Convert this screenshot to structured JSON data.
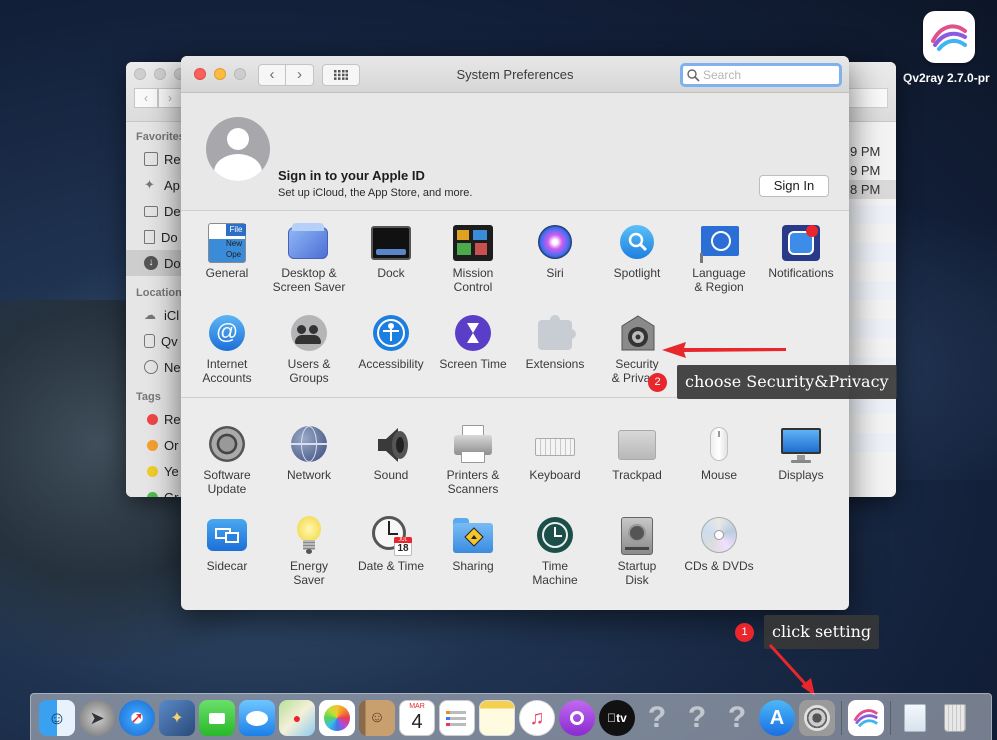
{
  "desktop": {
    "app_label": "Qv2ray 2.7.0-pr"
  },
  "finder": {
    "favorites_head": "Favorites",
    "favorites": [
      "Re",
      "Ap",
      "De",
      "Do",
      "Do"
    ],
    "locations_head": "Location",
    "locations": [
      "iCl",
      "Qv",
      "Ne"
    ],
    "tags_head": "Tags",
    "tags": [
      {
        "label": "Re",
        "color": "#f04646"
      },
      {
        "label": "Or",
        "color": "#f5a030"
      },
      {
        "label": "Ye",
        "color": "#f1cc2c"
      },
      {
        "label": "Gr",
        "color": "#4cbd4a"
      }
    ],
    "times": [
      "9 PM",
      "9 PM",
      "8 PM"
    ]
  },
  "window": {
    "title": "System Preferences",
    "search_placeholder": "Search"
  },
  "apple_id": {
    "title": "Sign in to your Apple ID",
    "subtitle": "Set up iCloud, the App Store, and more.",
    "button": "Sign In"
  },
  "panes_personal": [
    {
      "id": "general",
      "l1": "General",
      "l2": ""
    },
    {
      "id": "desktop",
      "l1": "Desktop &",
      "l2": "Screen Saver"
    },
    {
      "id": "dock",
      "l1": "Dock",
      "l2": ""
    },
    {
      "id": "mission",
      "l1": "Mission",
      "l2": "Control"
    },
    {
      "id": "siri",
      "l1": "Siri",
      "l2": ""
    },
    {
      "id": "spotlight",
      "l1": "Spotlight",
      "l2": ""
    },
    {
      "id": "language",
      "l1": "Language",
      "l2": "& Region"
    },
    {
      "id": "notifications",
      "l1": "Notifications",
      "l2": ""
    },
    {
      "id": "internet",
      "l1": "Internet",
      "l2": "Accounts"
    },
    {
      "id": "users",
      "l1": "Users &",
      "l2": "Groups"
    },
    {
      "id": "accessibility",
      "l1": "Accessibility",
      "l2": ""
    },
    {
      "id": "screentime",
      "l1": "Screen Time",
      "l2": ""
    },
    {
      "id": "extensions",
      "l1": "Extensions",
      "l2": ""
    },
    {
      "id": "security",
      "l1": "Security",
      "l2": "& Privacy"
    }
  ],
  "panes_hardware": [
    {
      "id": "swupdate",
      "l1": "Software",
      "l2": "Update"
    },
    {
      "id": "network",
      "l1": "Network",
      "l2": ""
    },
    {
      "id": "sound",
      "l1": "Sound",
      "l2": ""
    },
    {
      "id": "printers",
      "l1": "Printers &",
      "l2": "Scanners"
    },
    {
      "id": "keyboard",
      "l1": "Keyboard",
      "l2": ""
    },
    {
      "id": "trackpad",
      "l1": "Trackpad",
      "l2": ""
    },
    {
      "id": "mouse",
      "l1": "Mouse",
      "l2": ""
    },
    {
      "id": "displays",
      "l1": "Displays",
      "l2": ""
    },
    {
      "id": "sidecar",
      "l1": "Sidecar",
      "l2": ""
    },
    {
      "id": "energy",
      "l1": "Energy",
      "l2": "Saver"
    },
    {
      "id": "datetime",
      "l1": "Date & Time",
      "l2": ""
    },
    {
      "id": "sharing",
      "l1": "Sharing",
      "l2": ""
    },
    {
      "id": "timemachine",
      "l1": "Time",
      "l2": "Machine"
    },
    {
      "id": "startup",
      "l1": "Startup",
      "l2": "Disk"
    },
    {
      "id": "cds",
      "l1": "CDs & DVDs",
      "l2": ""
    }
  ],
  "file_icon_text": {
    "top": "File",
    "mid": "New",
    "bottom": "Ope"
  },
  "calendar_icon": {
    "month": "JUL",
    "day": "18"
  },
  "annotations": {
    "step1_badge": "1",
    "step1_text": "click setting",
    "step2_badge": "2",
    "step2_text": "choose Security&Privacy"
  },
  "dock": {
    "calendar_month": "MAR",
    "calendar_day": "4",
    "tv_label": "tv",
    "items": [
      "finder-icon",
      "launchpad-icon",
      "safari-icon",
      "photo-preview-icon",
      "facetime-icon",
      "messages-icon",
      "maps-icon",
      "photos-icon",
      "contacts-icon",
      "calendar-icon",
      "reminders-icon",
      "notes-icon",
      "music-icon",
      "podcasts-icon",
      "tv-icon",
      "unknown-app-icon",
      "unknown-app-icon",
      "unknown-app-icon",
      "app-store-icon",
      "system-preferences-icon"
    ]
  },
  "colors": {
    "accent_blue": "#2a7cf7",
    "callout_bg": "#373737",
    "badge_red": "#e8262c"
  }
}
